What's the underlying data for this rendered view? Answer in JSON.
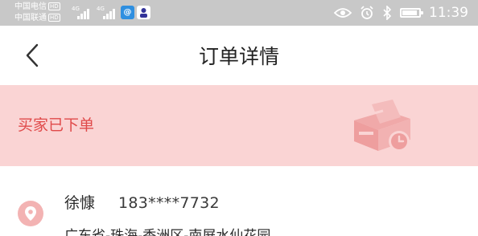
{
  "status_bar": {
    "carrier_1": "中国电信",
    "carrier_2": "中国联通",
    "hd_label": "HD",
    "network_1": "4G",
    "network_2": "4G",
    "time": "11:39",
    "battery_level": 0.9,
    "icons": [
      "eye-icon",
      "alarm-icon",
      "bluetooth-icon",
      "battery-icon"
    ]
  },
  "header": {
    "back_icon": "chevron-left-icon",
    "title": "订单详情"
  },
  "order": {
    "status": "买家已下单",
    "status_icon": "package-clock-icon",
    "banner_color": "#fad4d4",
    "status_color": "#e04a4a"
  },
  "address": {
    "icon": "location-pin-icon",
    "name": "徐慷",
    "phone": "183****7732",
    "address_line": "广东省-珠海-香洲区-南屏水仙花园"
  }
}
